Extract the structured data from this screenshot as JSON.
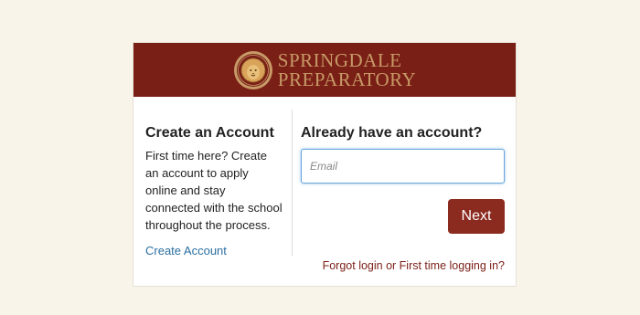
{
  "brand": {
    "name_line1": "SPRINGDALE",
    "name_line2": "PREPARATORY",
    "banner_color": "#7a1f16",
    "gold_color": "#c79a67",
    "logo_icon": "lion-seal-icon"
  },
  "create_account": {
    "title": "Create an Account",
    "description": "First time here? Create an account to apply online and stay connected with the school throughout the process.",
    "link_label": "Create Account"
  },
  "login": {
    "title": "Already have an account?",
    "email_placeholder": "Email",
    "email_value": "",
    "next_label": "Next",
    "forgot_label": "Forgot login or First time logging in?"
  }
}
